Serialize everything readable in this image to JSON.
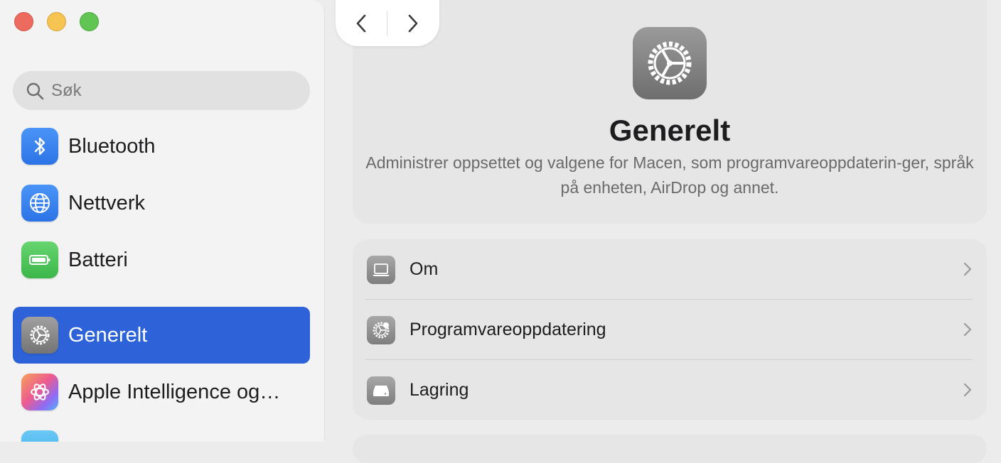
{
  "window": {
    "traffic_lights": [
      "close",
      "minimize",
      "zoom"
    ]
  },
  "search": {
    "placeholder": "Søk"
  },
  "sidebar": {
    "items": [
      {
        "label": "Bluetooth",
        "icon": "bluetooth-icon",
        "color": "#3b82f6"
      },
      {
        "label": "Nettverk",
        "icon": "globe-icon",
        "color": "#3b82f6"
      },
      {
        "label": "Batteri",
        "icon": "battery-icon",
        "color": "#4cc35a"
      },
      {
        "label": "Generelt",
        "icon": "gear-icon",
        "color": "#8a8a8a",
        "selected": true
      },
      {
        "label": "Apple Intelligence og…",
        "icon": "apple-intelligence-icon",
        "color": "#f08a5d"
      }
    ],
    "accent": "#2d62d8"
  },
  "nav": {
    "back": "back-arrow",
    "forward": "forward-arrow"
  },
  "main": {
    "title": "Generelt",
    "description": "Administrer oppsettet og valgene for Macen, som programvareoppdaterin-ger, språk på enheten, AirDrop og annet.",
    "rows": [
      {
        "label": "Om",
        "icon": "laptop-icon"
      },
      {
        "label": "Programvareoppdatering",
        "icon": "software-update-gear-icon"
      },
      {
        "label": "Lagring",
        "icon": "storage-drive-icon"
      }
    ]
  }
}
